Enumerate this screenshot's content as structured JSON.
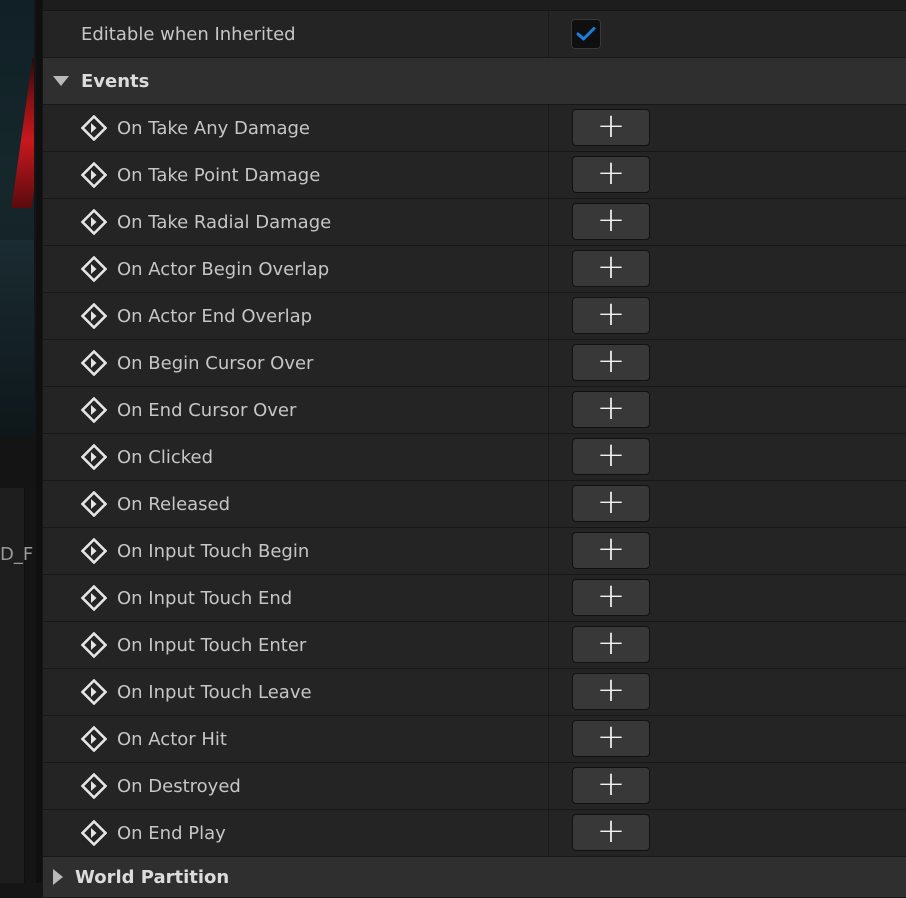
{
  "left_panel": {
    "cut_text": "D_F"
  },
  "editable_row": {
    "label": "Editable when Inherited",
    "checked": true
  },
  "events_category": {
    "label": "Events",
    "expanded": true
  },
  "events": [
    {
      "label": "On Take Any Damage",
      "button": "+"
    },
    {
      "label": "On Take Point Damage",
      "button": "+"
    },
    {
      "label": "On Take Radial Damage",
      "button": "+"
    },
    {
      "label": "On Actor Begin Overlap",
      "button": "+"
    },
    {
      "label": "On Actor End Overlap",
      "button": "+"
    },
    {
      "label": "On Begin Cursor Over",
      "button": "+"
    },
    {
      "label": "On End Cursor Over",
      "button": "+"
    },
    {
      "label": "On Clicked",
      "button": "+"
    },
    {
      "label": "On Released",
      "button": "+"
    },
    {
      "label": "On Input Touch Begin",
      "button": "+"
    },
    {
      "label": "On Input Touch End",
      "button": "+"
    },
    {
      "label": "On Input Touch Enter",
      "button": "+"
    },
    {
      "label": "On Input Touch Leave",
      "button": "+"
    },
    {
      "label": "On Actor Hit",
      "button": "+"
    },
    {
      "label": "On Destroyed",
      "button": "+"
    },
    {
      "label": "On End Play",
      "button": "+"
    }
  ],
  "world_partition_category": {
    "label": "World Partition",
    "expanded": false
  },
  "colors": {
    "accent": "#1a7fe0",
    "panel": "#242424",
    "category": "#2f2f2f"
  },
  "icons": {
    "event": "event-diamond-icon",
    "checkbox": "checkmark-icon",
    "add": "plus-icon"
  }
}
